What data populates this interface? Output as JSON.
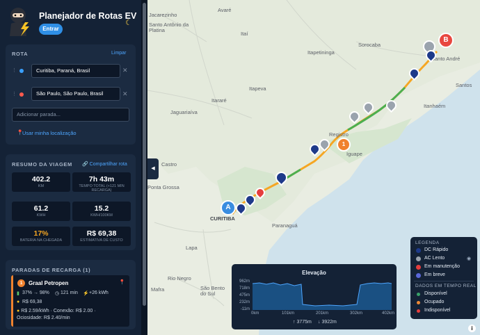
{
  "app": {
    "title": "Planejador de Rotas EV",
    "login": "Entrar",
    "moon": "☾"
  },
  "route": {
    "heading": "ROTA",
    "clear": "Limpar",
    "origin": "Curitiba, Paraná, Brasil",
    "destination": "São Paulo, São Paulo, Brasil",
    "add_stop_placeholder": "Adicionar parada...",
    "use_location": "Usar minha localização"
  },
  "summary": {
    "heading": "RESUMO DA VIAGEM",
    "share": "Compartilhar rota",
    "stats": [
      {
        "value": "402.2",
        "label": "KM",
        "color": "#ffffff"
      },
      {
        "value": "7h 43m",
        "label": "TEMPO TOTAL (+121 MIN RECARGA)",
        "color": "#ffffff"
      },
      {
        "value": "61.2",
        "label": "KWH",
        "color": "#ffffff"
      },
      {
        "value": "15.2",
        "label": "KWH/100KM",
        "color": "#ffffff"
      },
      {
        "value": "17%",
        "label": "BATERIA NA CHEGADA",
        "color": "#f5a623"
      },
      {
        "value": "R$ 69,38",
        "label": "ESTIMATIVA DE CUSTO",
        "color": "#ffffff"
      }
    ]
  },
  "stops": {
    "heading": "PARADAS DE RECARGA (1)",
    "items": [
      {
        "index": "1",
        "name": "Graal Petropen",
        "battery": "37% → 98%",
        "duration": "121 min",
        "energy": "+26 kWh",
        "cost": "R$ 69,38",
        "detail1": "R$ 2.59/kWh · Conexão: R$ 2.00 ·",
        "detail2": "Ociosidade: R$ 2.40/min"
      }
    ]
  },
  "map": {
    "labels": [
      "Avaré",
      "Jacarezinho",
      "Santo Antônio da Platina",
      "Itaí",
      "Sorocaba",
      "Itapetininga",
      "Itapeva",
      "Itararé",
      "Jaguariaíva",
      "Santos",
      "Itanhaém",
      "Iguape",
      "Registro",
      "Castro",
      "Ponta Grossa",
      "CURITIBA",
      "Paranaguá",
      "Lapa",
      "Rio Negro",
      "São Bento do Sul",
      "Mafra",
      "Santo André"
    ],
    "marker_a": "A",
    "marker_b": "B",
    "stop_marker": "1",
    "collapse_icon": "◀",
    "info": "i"
  },
  "legend": {
    "heading": "LEGENDA",
    "items": [
      "DC Rápido",
      "AC Lento",
      "Em manutenção",
      "Em breve"
    ],
    "realtime_heading": "DADOS EM TEMPO REAL",
    "status": [
      "Disponível",
      "Ocupado",
      "Indisponível"
    ],
    "colors": {
      "dc": "#1e3a8a",
      "ac": "#9aa3ad",
      "maint": "#e53e3e",
      "soon": "#5a67d8",
      "available": "#38a169",
      "busy": "#ed8936",
      "unavailable": "#e53e3e"
    }
  },
  "elevation": {
    "title": "Elevação",
    "yticks": [
      "962m",
      "718m",
      "475m",
      "232m",
      "-11m"
    ],
    "xticks": [
      "0km",
      "101km",
      "201km",
      "302km",
      "402km"
    ],
    "gain": "↑ 3775m",
    "loss": "↓ 3922m"
  }
}
